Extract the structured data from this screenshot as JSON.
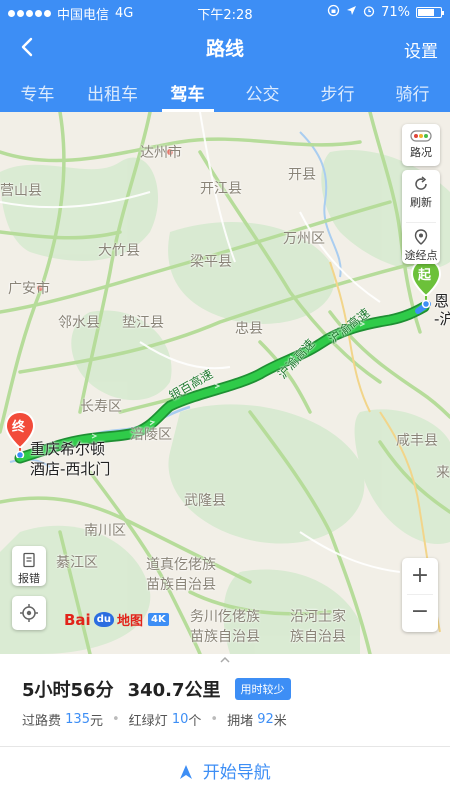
{
  "status": {
    "carrier": "中国电信",
    "network": "4G",
    "time": "下午2:28",
    "battery": "71%",
    "battery_level": 0.71
  },
  "header": {
    "title": "路线",
    "settings": "设置"
  },
  "tabs": [
    {
      "label": "专车",
      "active": false
    },
    {
      "label": "出租车",
      "active": false
    },
    {
      "label": "驾车",
      "active": true
    },
    {
      "label": "公交",
      "active": false
    },
    {
      "label": "步行",
      "active": false
    },
    {
      "label": "骑行",
      "active": false
    }
  ],
  "map": {
    "labels": {
      "dazhou": "达州市",
      "yingshan": "营山县",
      "kaijiang": "开江县",
      "kaixian": "开县",
      "dazhu": "大竹县",
      "liangping": "梁平县",
      "wanzhou": "万州区",
      "guangan": "广安市",
      "linshui": "邻水县",
      "dianjiang": "垫江县",
      "zhongxian": "忠县",
      "changshou": "长寿区",
      "fuling": "涪陵区",
      "wulong": "武隆县",
      "nanchuan": "南川区",
      "qijiang": "綦江区",
      "xianfeng": "咸丰县",
      "lai": "来",
      "daozhen": "道真仡佬族",
      "daozhen2": "苗族自治县",
      "wuchuan": "务川仡佬族",
      "wuchuan2": "苗族自治县",
      "yanhe": "沿河土家",
      "yanhe2": "族自治县",
      "dest_name": "重庆希尔顿",
      "dest_name2": "酒店-西北门",
      "origin_name": "恩",
      "origin_name2": "-沪",
      "road_yinbai": "银百高速",
      "road_huyu": "沪渝高速",
      "road_huyu2": "沪渝高速"
    },
    "controls": {
      "traffic": "路况",
      "refresh": "刷新",
      "waypoint": "途经点",
      "report": "报错",
      "zoom_in": "+",
      "zoom_out": "−"
    },
    "markers": {
      "start": "起",
      "end": "终"
    },
    "logo": {
      "brand": "Bai",
      "du": "du",
      "map": "地图",
      "ver": "4K"
    }
  },
  "route": {
    "duration": "5小时56分",
    "distance": "340.7公里",
    "tag": "用时较少",
    "toll_label": "过路费",
    "toll_value": "135",
    "toll_unit": "元",
    "lights_label": "红绿灯",
    "lights_value": "10",
    "lights_unit": "个",
    "congestion_label": "拥堵",
    "congestion_value": "92",
    "congestion_unit": "米",
    "start_nav": "开始导航"
  },
  "colors": {
    "brand": "#3d8ef5",
    "route": "#2fcb49",
    "route_border": "#1f8f33",
    "start_pin": "#6cc13a",
    "end_pin": "#f24b3a"
  }
}
